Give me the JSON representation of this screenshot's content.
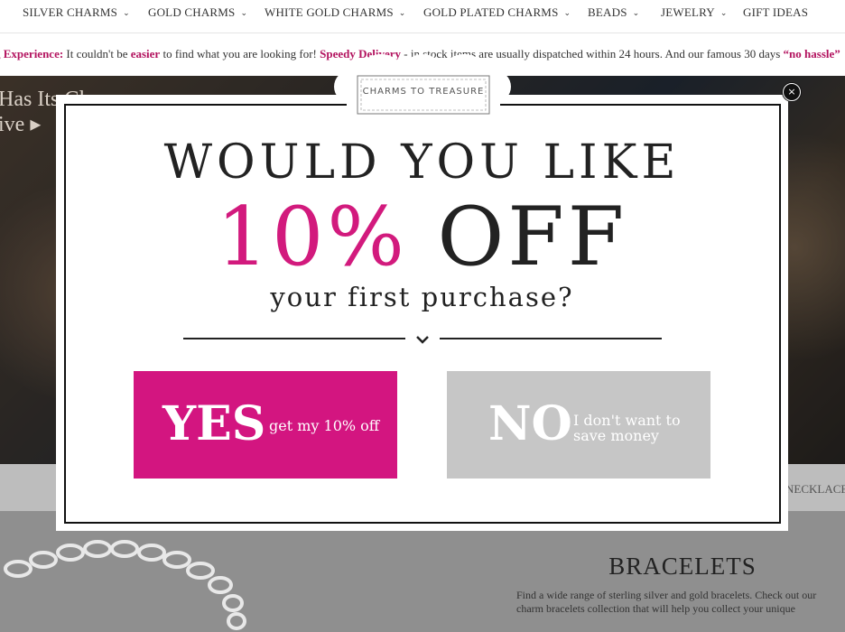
{
  "nav": {
    "items": [
      {
        "label": "SILVER CHARMS",
        "chevron": true
      },
      {
        "label": "GOLD CHARMS",
        "chevron": true
      },
      {
        "label": "WHITE GOLD CHARMS",
        "chevron": true
      },
      {
        "label": "GOLD PLATED CHARMS",
        "chevron": true
      },
      {
        "label": "BEADS",
        "chevron": true
      },
      {
        "label": "JEWELRY",
        "chevron": true
      },
      {
        "label": "GIFT IDEAS",
        "chevron": false
      }
    ],
    "chevron_glyph": "⌄"
  },
  "promo": {
    "lead": "g Experience:",
    "text1": " It couldn't be ",
    "easier": "easier",
    "text2": " to find what you are looking for! ",
    "speedy": "Speedy Delivery",
    "text3": " - in stock items are usually dispatched within 24 hours. And our famous 30 days ",
    "hassle": "“no hassle”"
  },
  "hero": {
    "line1": "Has Its Cl",
    "line2": "ive ▸"
  },
  "strip": {
    "text": "NECKLACE"
  },
  "bracelets": {
    "title": "BRACELETS",
    "line1": "Find a wide range of sterling silver and gold bracelets. Check out our",
    "line2": "charm bracelets collection that will help you collect your unique"
  },
  "popup": {
    "logo": "CHARMS TO TREASURE",
    "close_glyph": "×",
    "headline": "WOULD YOU LIKE",
    "percent": "10%",
    "off": "OFF",
    "subline": "your first purchase?",
    "yes_big": "YES",
    "yes_small": "get my 10% off",
    "no_big": "NO",
    "no_small_1": "I don't want to",
    "no_small_2": "save money"
  },
  "colors": {
    "accent": "#d21a7d",
    "no_button": "#c6c6c6",
    "promo_highlight": "#b3135f"
  },
  "icons": {
    "close": "close-icon",
    "chevron": "chevron-down-icon",
    "logo": "cloud-logo-icon"
  }
}
